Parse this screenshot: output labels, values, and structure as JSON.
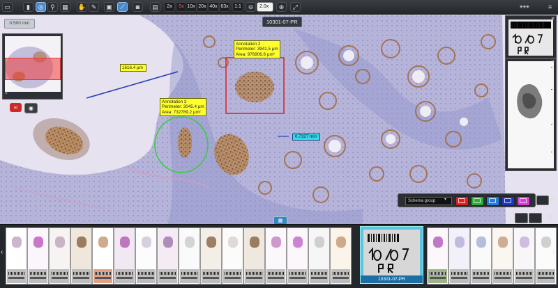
{
  "toolbar": {
    "buttons": [
      "screen-icon",
      "cursor-icon",
      "compass-icon",
      "search-icon",
      "grid-icon",
      "hand-icon",
      "pen-icon",
      "image-icon",
      "line-icon",
      "camera-icon",
      "grid2-icon"
    ],
    "zoom_levels": [
      "2x",
      "5x",
      "10x",
      "20x",
      "40x",
      "63x",
      "1:1"
    ],
    "zoom_input": "2.0x"
  },
  "viewer": {
    "slide_title": "10301-07-PR",
    "scale_label": "0.500 mm"
  },
  "annotations": {
    "ruler_label": "1616.4 µm",
    "annotation2": "Annotation 2\nPerimeter: 3941.5 µm\nArea: 976906.6 µm²",
    "annotation3": "Annotation 3\nPerimeter: 3045.4 µm\nArea: 732789.2 µm²",
    "point_label": "0.7327 mm"
  },
  "schema": {
    "group_label": "Schema group",
    "colors": [
      "#e02020",
      "#27b034",
      "#1f7ee0",
      "#1e36c4",
      "#d83ad8"
    ]
  },
  "filmstrip": {
    "selected_caption": "10301-07-PR",
    "thumbnail_count": 26
  }
}
